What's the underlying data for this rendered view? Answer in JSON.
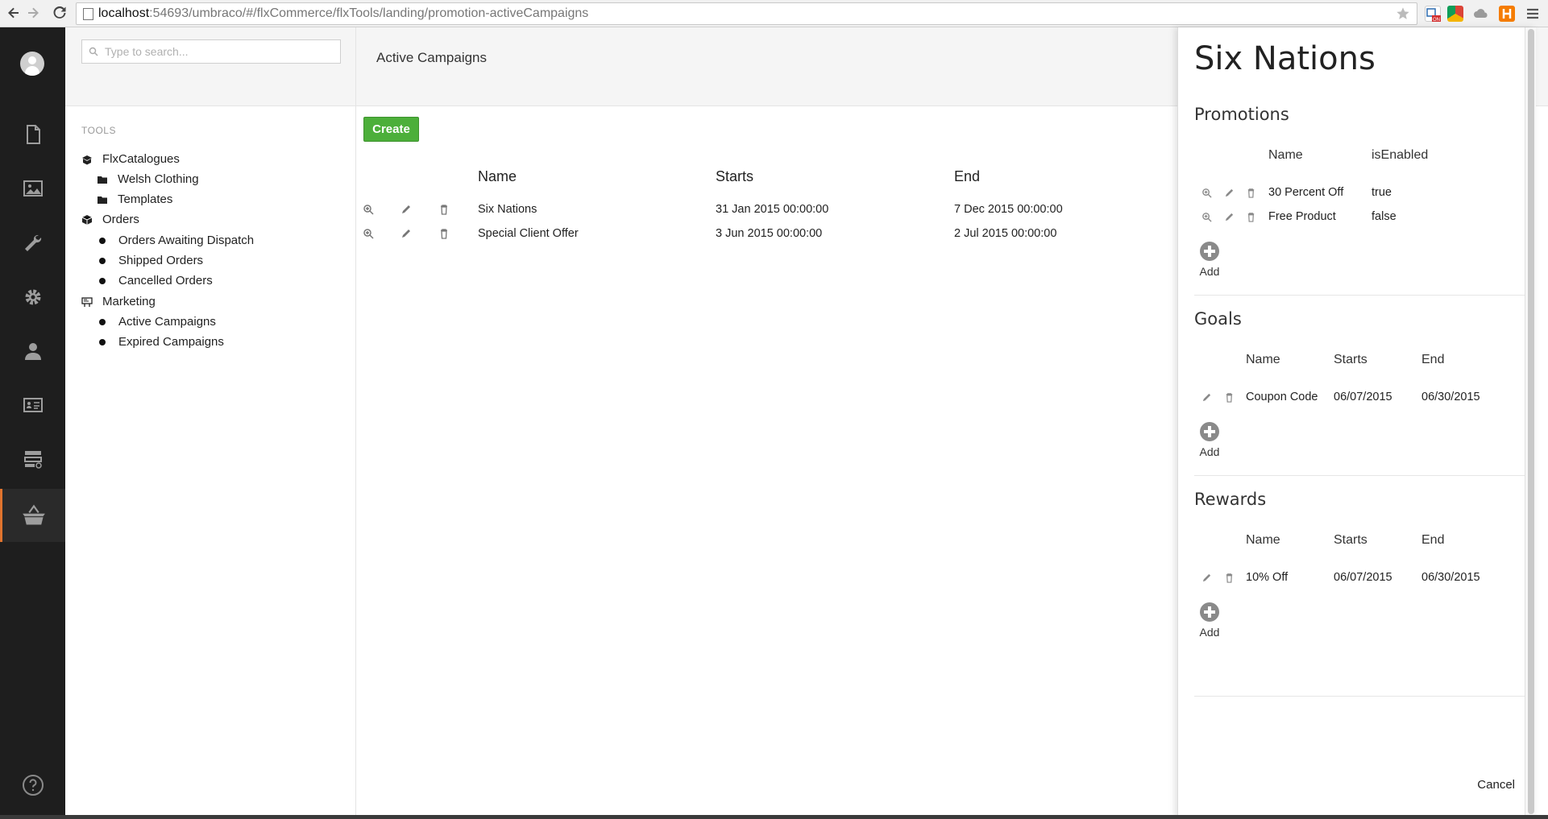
{
  "browser": {
    "url_host": "localhost",
    "url_path": ":54693/umbraco/#/flxCommerce/flxTools/landing/promotion-activeCampaigns"
  },
  "appbar": {
    "sections": [
      "content",
      "media",
      "developer",
      "settings",
      "users",
      "members",
      "forms",
      "commerce"
    ],
    "help_icon": "help-icon"
  },
  "tree": {
    "search_placeholder": "Type to search...",
    "section_title": "TOOLS",
    "items": [
      {
        "label": "FlxCatalogues",
        "icon": "box-open-icon"
      },
      {
        "label": "Welsh Clothing",
        "icon": "folder-icon"
      },
      {
        "label": "Templates",
        "icon": "folder-icon"
      },
      {
        "label": "Orders",
        "icon": "box-icon"
      },
      {
        "label": "Orders Awaiting Dispatch",
        "icon": "dot-icon"
      },
      {
        "label": "Shipped Orders",
        "icon": "dot-icon"
      },
      {
        "label": "Cancelled Orders",
        "icon": "dot-icon"
      },
      {
        "label": "Marketing",
        "icon": "billboard-icon"
      },
      {
        "label": "Active Campaigns",
        "icon": "dot-icon"
      },
      {
        "label": "Expired Campaigns",
        "icon": "dot-icon"
      }
    ]
  },
  "main": {
    "title": "Active Campaigns",
    "create_label": "Create",
    "columns": [
      "Name",
      "Starts",
      "End"
    ],
    "rows": [
      {
        "name": "Six Nations",
        "starts": "31 Jan 2015 00:00:00",
        "end": "7 Dec 2015 00:00:00"
      },
      {
        "name": "Special Client Offer",
        "starts": "3 Jun 2015 00:00:00",
        "end": "2 Jul 2015 00:00:00"
      }
    ]
  },
  "overlay": {
    "title": "Six Nations",
    "promotions": {
      "heading": "Promotions",
      "columns": [
        "Name",
        "isEnabled"
      ],
      "rows": [
        {
          "name": "30 Percent Off",
          "enabled": "true"
        },
        {
          "name": "Free Product",
          "enabled": "false"
        }
      ],
      "add_label": "Add"
    },
    "goals": {
      "heading": "Goals",
      "columns": [
        "Name",
        "Starts",
        "End"
      ],
      "rows": [
        {
          "name": "Coupon Code",
          "starts": "06/07/2015",
          "end": "06/30/2015"
        }
      ],
      "add_label": "Add"
    },
    "rewards": {
      "heading": "Rewards",
      "columns": [
        "Name",
        "Starts",
        "End"
      ],
      "rows": [
        {
          "name": "10% Off",
          "starts": "06/07/2015",
          "end": "06/30/2015"
        }
      ],
      "add_label": "Add"
    },
    "cancel_label": "Cancel"
  },
  "colors": {
    "create_button": "#4caf3a",
    "active_section_accent": "#e0742e",
    "appbar_bg": "#1e1e1e"
  }
}
